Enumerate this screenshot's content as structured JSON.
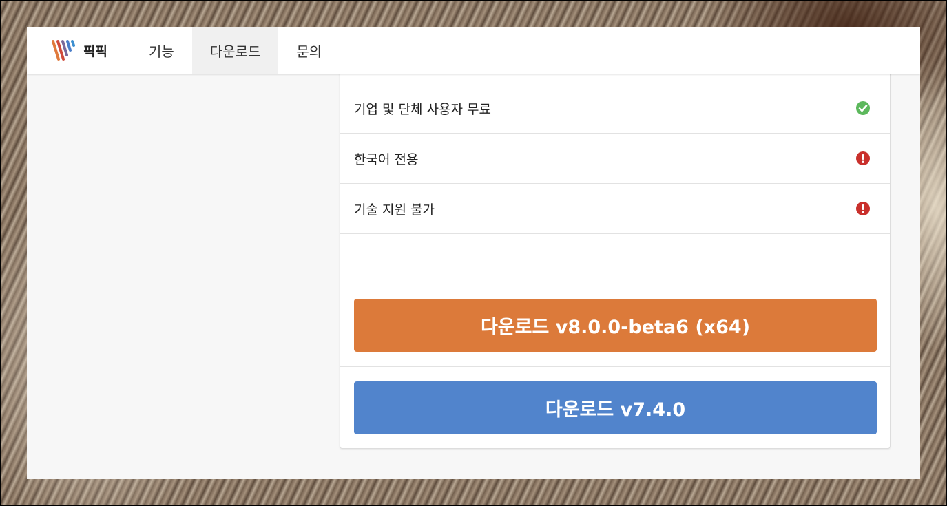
{
  "brand": {
    "name": "픽픽"
  },
  "nav": {
    "items": [
      {
        "label": "기능"
      },
      {
        "label": "다운로드"
      },
      {
        "label": "문의"
      }
    ]
  },
  "features": [
    {
      "label": "기업 및 단체 사용자 무료",
      "status": "check-icon"
    },
    {
      "label": "한국어 전용",
      "status": "warning-icon"
    },
    {
      "label": "기술 지원 불가",
      "status": "warning-icon"
    }
  ],
  "downloads": {
    "beta_label": "다운로드 v8.0.0-beta6 (x64)",
    "stable_label": "다운로드 v7.4.0"
  },
  "colors": {
    "beta_button": "#dc7a3a",
    "stable_button": "#5184cc",
    "check": "#5cb85c",
    "warning": "#c9302c"
  }
}
